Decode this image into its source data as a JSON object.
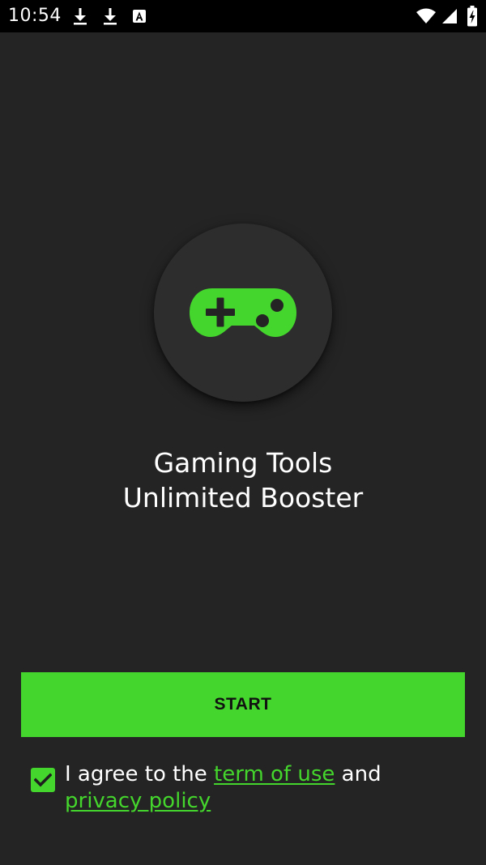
{
  "status_bar": {
    "time": "10:54",
    "icons": [
      "download-icon",
      "download-icon",
      "accessibility-a-icon",
      "wifi-icon",
      "signal-icon",
      "battery-charging-icon"
    ]
  },
  "logo": {
    "icon": "gamepad-icon",
    "accent_color": "#44d62c"
  },
  "app": {
    "title_line1": "Gaming Tools",
    "title_line2": "Unlimited Booster"
  },
  "start_button": {
    "label": "START",
    "color": "#44d62c"
  },
  "agreement": {
    "checked": true,
    "text_prefix": "I agree to the ",
    "terms_link": "term of use",
    "text_middle": " and ",
    "privacy_link": "privacy policy"
  }
}
